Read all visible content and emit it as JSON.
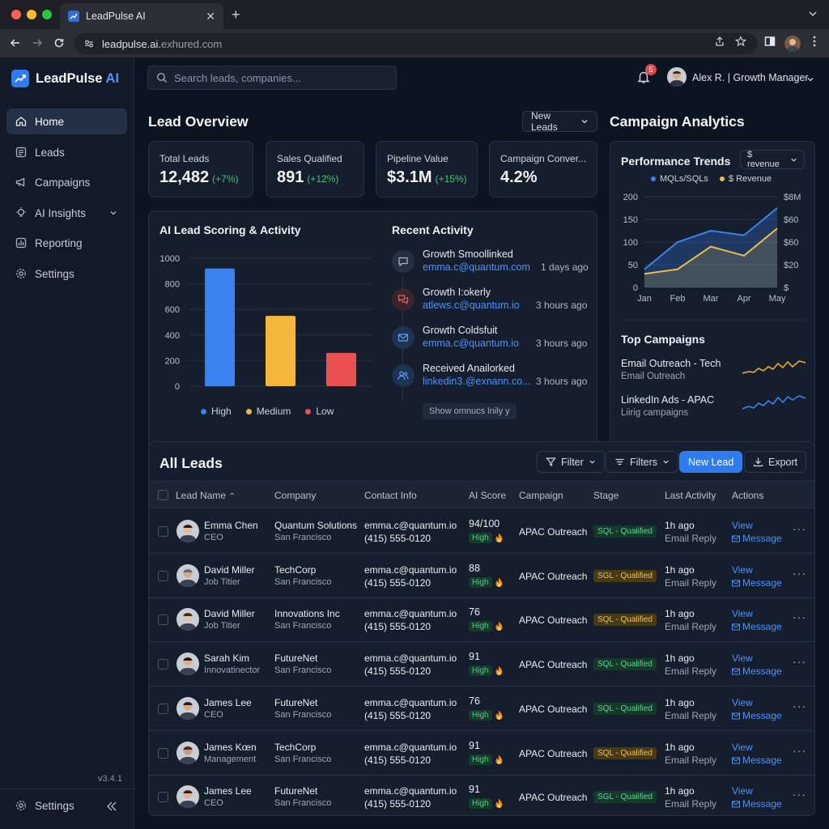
{
  "browser": {
    "tab_title": "LeadPulse AI",
    "url_host": "leadpulse.ai.",
    "url_rest": "exhured.com"
  },
  "brand": {
    "name": "LeadPulse",
    "suffix": "AI"
  },
  "sidebar": {
    "items": [
      {
        "label": "Home",
        "icon": "home-icon"
      },
      {
        "label": "Leads",
        "icon": "list-icon"
      },
      {
        "label": "Campaigns",
        "icon": "megaphone-icon"
      },
      {
        "label": "AI Insights",
        "icon": "bulb-icon"
      },
      {
        "label": "Reporting",
        "icon": "chart-icon"
      },
      {
        "label": "Settings",
        "icon": "gear-icon"
      }
    ],
    "version": "v3.4.1",
    "bottom_settings": "Settings"
  },
  "header": {
    "search_placeholder": "Search leads, companies...",
    "notifications": "5",
    "user_label": "Alex R. | Growth Manager"
  },
  "overview": {
    "title": "Lead Overview",
    "filter": "New Leads",
    "kpis": [
      {
        "label": "Total Leads",
        "value": "12,482",
        "delta": "(+7%)"
      },
      {
        "label": "Sales Qualified",
        "value": "891",
        "delta": "(+12%)"
      },
      {
        "label": "Pipeline Value",
        "value": "$3.1M",
        "delta": "(+15%)"
      },
      {
        "label": "Campaign Conver...",
        "value": "4.2%",
        "delta": ""
      }
    ]
  },
  "scoring": {
    "title": "AI Lead Scoring & Activity",
    "legend": [
      "High",
      "Medium",
      "Low"
    ]
  },
  "activity": {
    "title": "Recent Activity",
    "items": [
      {
        "title": "Growth Smoollinked",
        "sub": "emma.c@quantum.com",
        "time": "1 days ago",
        "icon": "chat-icon"
      },
      {
        "title": "Growth I:okerly",
        "sub": "atlews.c@quantum.io",
        "time": "3 hours ago",
        "icon": "messages-icon"
      },
      {
        "title": "Growth Coldsfuit",
        "sub": "emma.c@quantum.io",
        "time": "3 hours ago",
        "icon": "mail-icon"
      },
      {
        "title": "Received Anailorked",
        "sub": "linkedin3.@exnann.co...",
        "time": "3 hours ago",
        "icon": "users-icon"
      }
    ],
    "show_more": "Show omnucs lnily y"
  },
  "campaign": {
    "title": "Campaign Analytics",
    "trends_title": "Performance Trends",
    "trends_filter": "$ revenue",
    "top_title": "Top Campaigns",
    "top": [
      {
        "name": "Email Outreach - Tech",
        "sub": "Email Outreach"
      },
      {
        "name": "LinkedIn Ads - APAC",
        "sub": "Liirig campaigns"
      }
    ]
  },
  "chart_data": [
    {
      "type": "bar",
      "title": "AI Lead Scoring & Activity",
      "categories": [
        "High",
        "Medium",
        "Low"
      ],
      "values": [
        920,
        550,
        260
      ],
      "ylim": [
        0,
        1000
      ],
      "yticks": [
        "1000",
        "800",
        "600",
        "400",
        "200",
        "0"
      ],
      "colors": [
        "#3b82f0",
        "#f5b63c",
        "#ea5050"
      ],
      "grid": true,
      "legend": "bottom"
    },
    {
      "type": "line",
      "title": "Performance Trends",
      "categories": [
        "Jan",
        "Feb",
        "Mar",
        "Apr",
        "May"
      ],
      "series": [
        {
          "name": "MQLs/SQLs",
          "values": [
            40,
            100,
            125,
            115,
            175
          ],
          "color": "#3b82f0"
        },
        {
          "name": "$ Revenue",
          "values": [
            30,
            40,
            90,
            70,
            130
          ],
          "color": "#e9c04a"
        }
      ],
      "ylim": [
        0,
        200
      ],
      "yticks_left": [
        "200",
        "150",
        "100",
        "50",
        "0"
      ],
      "yticks_right": [
        "$8M",
        "$60",
        "$60",
        "$20",
        "$"
      ],
      "legend": "top"
    }
  ],
  "table": {
    "title": "All Leads",
    "filter_label": "Filter",
    "filters_label": "Filters",
    "new_lead_label": "New Lead",
    "export_label": "Export",
    "columns": [
      "Lead Name",
      "Company",
      "Contact Info",
      "AI Score",
      "Campaign",
      "Stage",
      "Last Activity",
      "Actions"
    ],
    "view_label": "View",
    "message_label": "Message",
    "rows": [
      {
        "name": "Emma Chen",
        "title": "CEO",
        "company": "Quantum Solutions",
        "city": "San Francisco",
        "email": "emma.c@quantum.io",
        "phone": "(415) 555-0120",
        "score": "94/100",
        "badge": "High",
        "campaign": "APAC Outreach",
        "stage": "SQL - Qualified",
        "stage_color": "green",
        "time": "1h ago",
        "activity": "Email Reply"
      },
      {
        "name": "David Miller",
        "title": "Job Titier",
        "company": "TechCorp",
        "city": "San Francisco",
        "email": "emma.c@quantum.io",
        "phone": "(415) 555-0120",
        "score": "88",
        "badge": "High",
        "campaign": "APAC Outreach",
        "stage": "SGL - Qualified",
        "stage_color": "amber",
        "time": "1h ago",
        "activity": "Email Reply"
      },
      {
        "name": "David Miller",
        "title": "Job Titier",
        "company": "Innovations Inc",
        "city": "San Francisco",
        "email": "emma.c@quantum.io",
        "phone": "(415) 555-0120",
        "score": "76",
        "badge": "High",
        "campaign": "APAC Outreach",
        "stage": "SQL - Qualified",
        "stage_color": "amber",
        "time": "1h ago",
        "activity": "Email Reply"
      },
      {
        "name": "Sarah Kim",
        "title": "Innovatinector",
        "company": "FutureNet",
        "city": "San Francisco",
        "email": "emma.c@quantum.io",
        "phone": "(415) 555-0120",
        "score": "91",
        "badge": "High",
        "campaign": "APAC Outreach",
        "stage": "SQL - Qualified",
        "stage_color": "green",
        "time": "1h ago",
        "activity": "Email Reply"
      },
      {
        "name": "James Lee",
        "title": "CEO",
        "company": "FutureNet",
        "city": "San Francisco",
        "email": "emma.c@quantum.io",
        "phone": "(415) 555-0120",
        "score": "76",
        "badge": "High",
        "campaign": "APAC Outreach",
        "stage": "SQL - Qualified",
        "stage_color": "green",
        "time": "1h ago",
        "activity": "Email Reply"
      },
      {
        "name": "James Kœn",
        "title": "Management",
        "company": "TechCorp",
        "city": "San Francisco",
        "email": "emma.c@quantum.io",
        "phone": "(415) 555-0120",
        "score": "91",
        "badge": "High",
        "campaign": "APAC Outreach",
        "stage": "SQL - Qualified",
        "stage_color": "amber",
        "time": "1h ago",
        "activity": "Email Reply"
      },
      {
        "name": "James Lee",
        "title": "CEO",
        "company": "FutureNet",
        "city": "San Francisco",
        "email": "emma.c@quantum.io",
        "phone": "(415) 555-0120",
        "score": "91",
        "badge": "High",
        "campaign": "APAC Outreach",
        "stage": "SGL - Qualified",
        "stage_color": "green",
        "time": "1h ago",
        "activity": "Email Reply"
      }
    ]
  }
}
